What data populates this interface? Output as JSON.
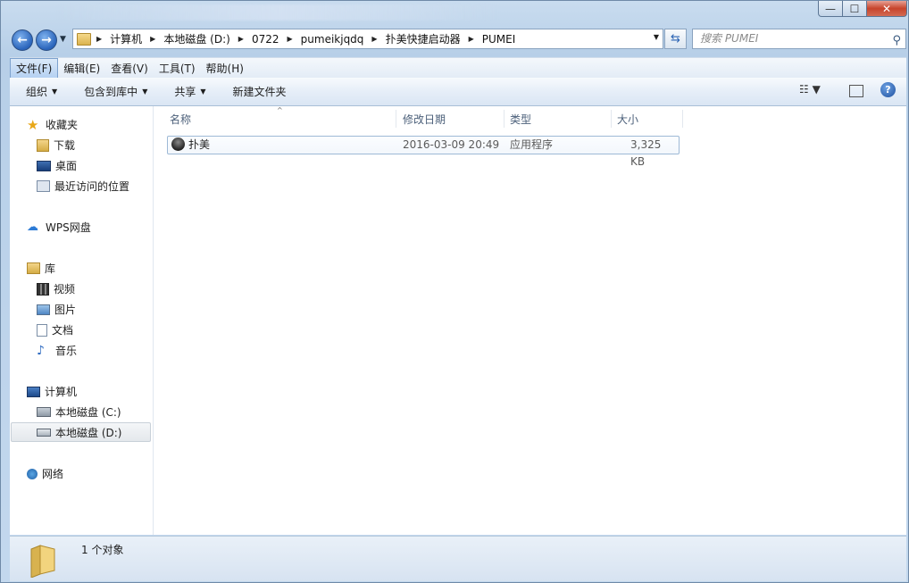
{
  "window": {
    "controls": {
      "minimize": "—",
      "maximize": "☐",
      "close": "✕"
    }
  },
  "address": {
    "crumbs": [
      "计算机",
      "本地磁盘 (D:)",
      "0722",
      "pumeikjqdq",
      "扑美快捷启动器",
      "PUMEI"
    ],
    "search_placeholder": "搜索 PUMEI"
  },
  "menubar": {
    "items": [
      "文件(F)",
      "编辑(E)",
      "查看(V)",
      "工具(T)",
      "帮助(H)"
    ]
  },
  "toolbar": {
    "organize": "组织",
    "include_library": "包含到库中",
    "share": "共享",
    "new_folder": "新建文件夹"
  },
  "sidebar": {
    "favorites": {
      "label": "收藏夹",
      "items": [
        "下载",
        "桌面",
        "最近访问的位置"
      ]
    },
    "wps": "WPS网盘",
    "library": {
      "label": "库",
      "items": [
        "视频",
        "图片",
        "文档",
        "音乐"
      ]
    },
    "computer": {
      "label": "计算机",
      "items": [
        "本地磁盘 (C:)",
        "本地磁盘 (D:)"
      ]
    },
    "network": "网络"
  },
  "columns": [
    "名称",
    "修改日期",
    "类型",
    "大小"
  ],
  "files": [
    {
      "name": "扑美",
      "modified": "2016-03-09 20:49",
      "type": "应用程序",
      "size": "3,325 KB"
    }
  ],
  "status": {
    "text": "1 个对象"
  },
  "colors": {
    "accent": "#2a64bb",
    "selection_border": "#9eb9d6"
  }
}
